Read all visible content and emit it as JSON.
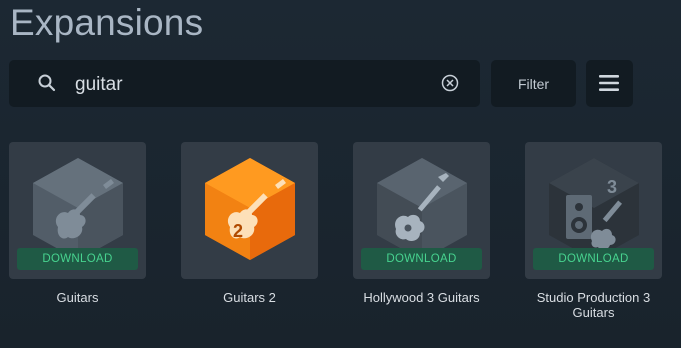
{
  "header": {
    "title": "Expansions"
  },
  "search": {
    "value": "guitar"
  },
  "toolbar": {
    "filter_label": "Filter"
  },
  "cards": [
    {
      "name": "Guitars",
      "action": "DOWNLOAD"
    },
    {
      "name": "Guitars 2"
    },
    {
      "name": "Hollywood 3 Guitars",
      "action": "DOWNLOAD"
    },
    {
      "name": "Studio Production 3 Guitars",
      "action": "DOWNLOAD"
    }
  ],
  "colors": {
    "accent_orange": "#f07a14",
    "download_green": "#47d38f"
  }
}
